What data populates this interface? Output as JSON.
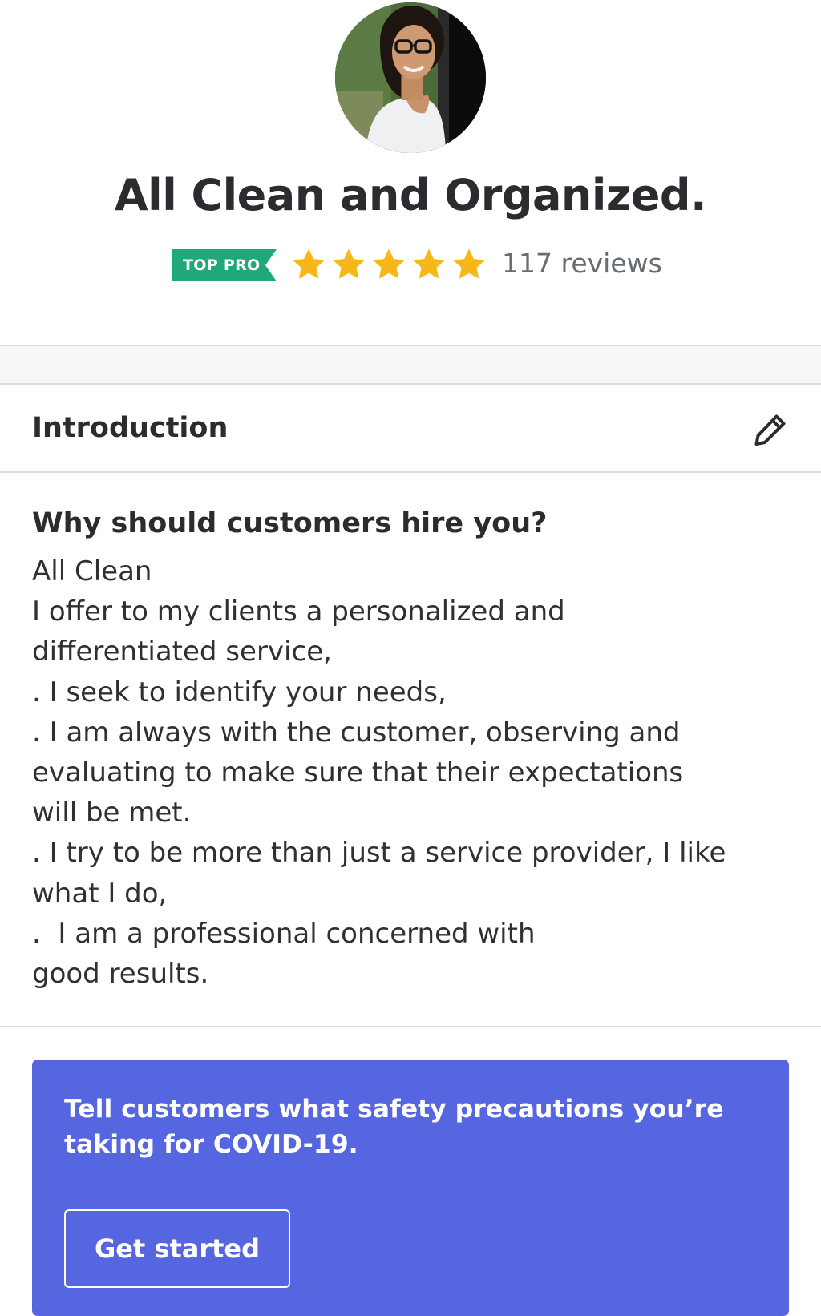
{
  "profile": {
    "avatar_icon": "profile-photo",
    "business_name": "All Clean and Organized.",
    "badge_label": "TOP PRO",
    "badge_color": "#1fa87a",
    "rating": 5,
    "rating_max": 5,
    "star_color": "#f7b718",
    "review_count": "117 reviews"
  },
  "introduction": {
    "title": "Introduction",
    "edit_icon": "pencil-icon"
  },
  "why_hire": {
    "question": "Why should customers hire you?",
    "answer_lines": [
      "All Clean",
      "I offer to my clients a personalized and",
      "differentiated service,",
      ". I seek to identify your needs,",
      ". I am always with the customer, observing and",
      "evaluating to make sure that their expectations",
      "will be met.",
      ". I try to be more than just a service provider, I like",
      "what I do,",
      ".  I am a professional concerned with",
      "good results."
    ]
  },
  "covid_promo": {
    "background_color": "#5566e0",
    "text_lines": [
      "Tell customers what safety precautions you’re",
      "taking for COVID-19."
    ],
    "button_label": "Get started"
  }
}
